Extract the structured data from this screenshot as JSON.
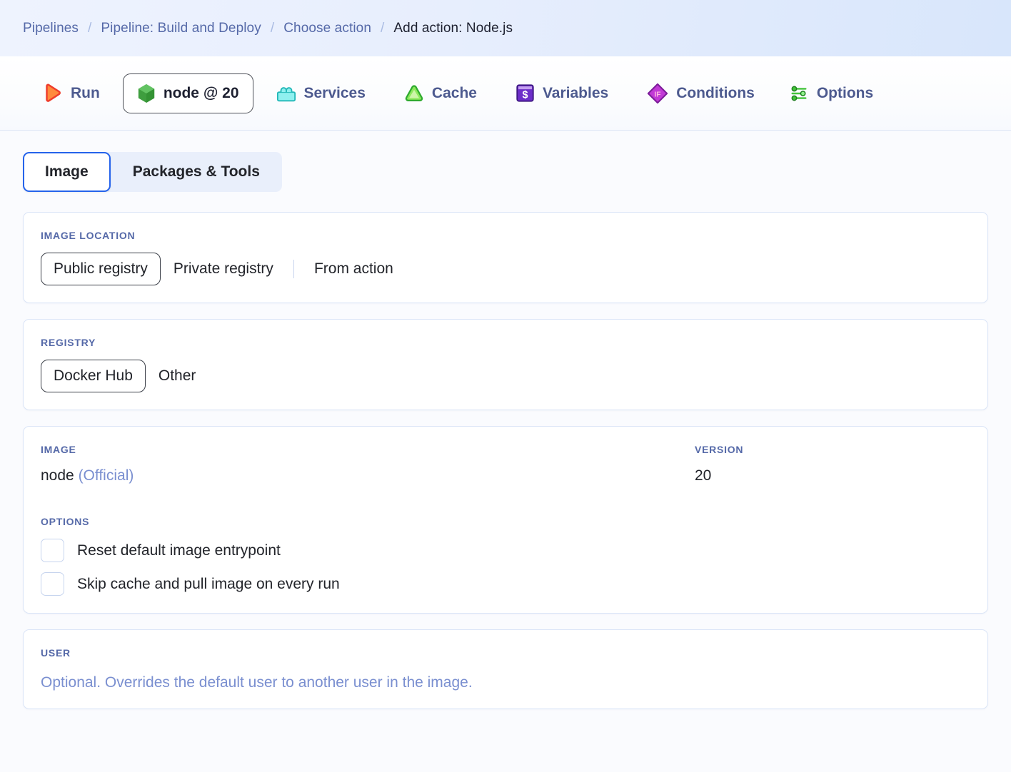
{
  "breadcrumb": {
    "separator": "/",
    "items": [
      {
        "label": "Pipelines",
        "current": false
      },
      {
        "label": "Pipeline: Build and Deploy",
        "current": false
      },
      {
        "label": "Choose action",
        "current": false
      },
      {
        "label": "Add action: Node.js",
        "current": true
      }
    ]
  },
  "toolbar": {
    "run_label": "Run",
    "image_chip_label": "node @ 20",
    "services_label": "Services",
    "cache_label": "Cache",
    "variables_label": "Variables",
    "variables_glyph": "$",
    "conditions_label": "Conditions",
    "conditions_glyph": "IF",
    "options_label": "Options",
    "icons": {
      "run": "play-triangle-icon",
      "image_chip": "nodejs-hexagon-icon",
      "services": "toolbox-icon",
      "cache": "cache-triangle-icon",
      "variables": "variables-square-icon",
      "conditions": "conditions-diamond-icon",
      "options": "sliders-icon"
    }
  },
  "tabs": [
    {
      "label": "Image",
      "active": true
    },
    {
      "label": "Packages & Tools",
      "active": false
    }
  ],
  "image_location": {
    "label": "Image location",
    "options": [
      {
        "label": "Public registry",
        "selected": true
      },
      {
        "label": "Private registry",
        "selected": false
      },
      {
        "label": "From action",
        "selected": false
      }
    ]
  },
  "registry": {
    "label": "Registry",
    "options": [
      {
        "label": "Docker Hub",
        "selected": true
      },
      {
        "label": "Other",
        "selected": false
      }
    ]
  },
  "image_section": {
    "image_label": "Image",
    "version_label": "Version",
    "image_name": "node",
    "image_badge": "(Official)",
    "version_value": "20",
    "options_label": "Options",
    "checkboxes": [
      {
        "label": "Reset default image entrypoint",
        "checked": false
      },
      {
        "label": "Skip cache and pull image on every run",
        "checked": false
      }
    ]
  },
  "user_section": {
    "label": "User",
    "placeholder": "Optional. Overrides the default user to another user in the image."
  },
  "colors": {
    "accent_blue": "#2563eb",
    "label_blue": "#5569a8",
    "muted_blue": "#7a8fd0",
    "text_dark": "#22242a",
    "card_border": "#dbe5f7",
    "page_bg": "#fafbfe",
    "breadcrumb_bg": "#e7eefd",
    "node_green": "#4caf50",
    "run_red": "#ef3c2b",
    "run_orange": "#ff9a4d",
    "services_cyan": "#3fd8d8",
    "cache_green": "#3ec93e",
    "variables_purple": "#6d2ec9",
    "conditions_magenta": "#c13ad6",
    "options_green": "#43c43a"
  }
}
